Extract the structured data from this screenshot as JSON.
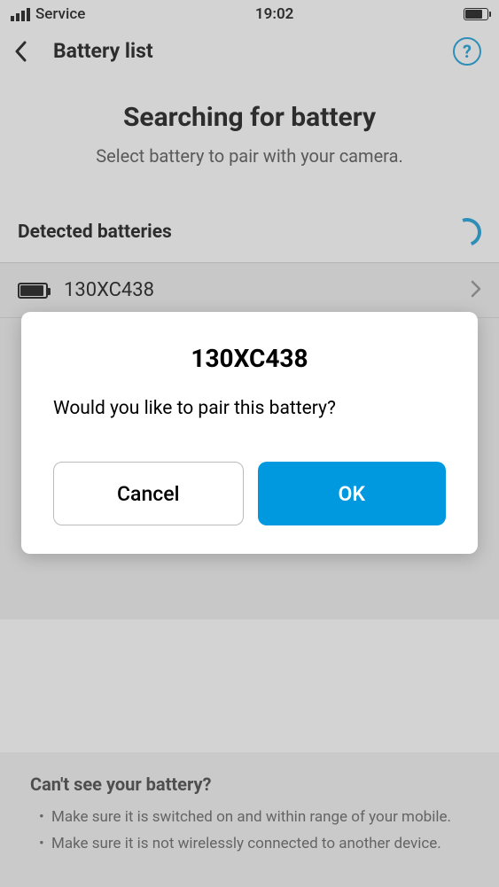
{
  "status": {
    "carrier": "Service",
    "time": "19:02"
  },
  "nav": {
    "title": "Battery list"
  },
  "searching": {
    "title": "Searching for battery",
    "subtitle": "Select battery to pair with your camera."
  },
  "detected": {
    "label": "Detected batteries",
    "items": [
      {
        "name": "130XC438"
      }
    ]
  },
  "help": {
    "title": "Can't see your battery?",
    "items": [
      "Make sure it is switched on and within range of your mobile.",
      "Make sure it is not wirelessly connected to another device."
    ]
  },
  "dialog": {
    "title": "130XC438",
    "message": "Would you like to pair this battery?",
    "cancel": "Cancel",
    "ok": "OK"
  }
}
